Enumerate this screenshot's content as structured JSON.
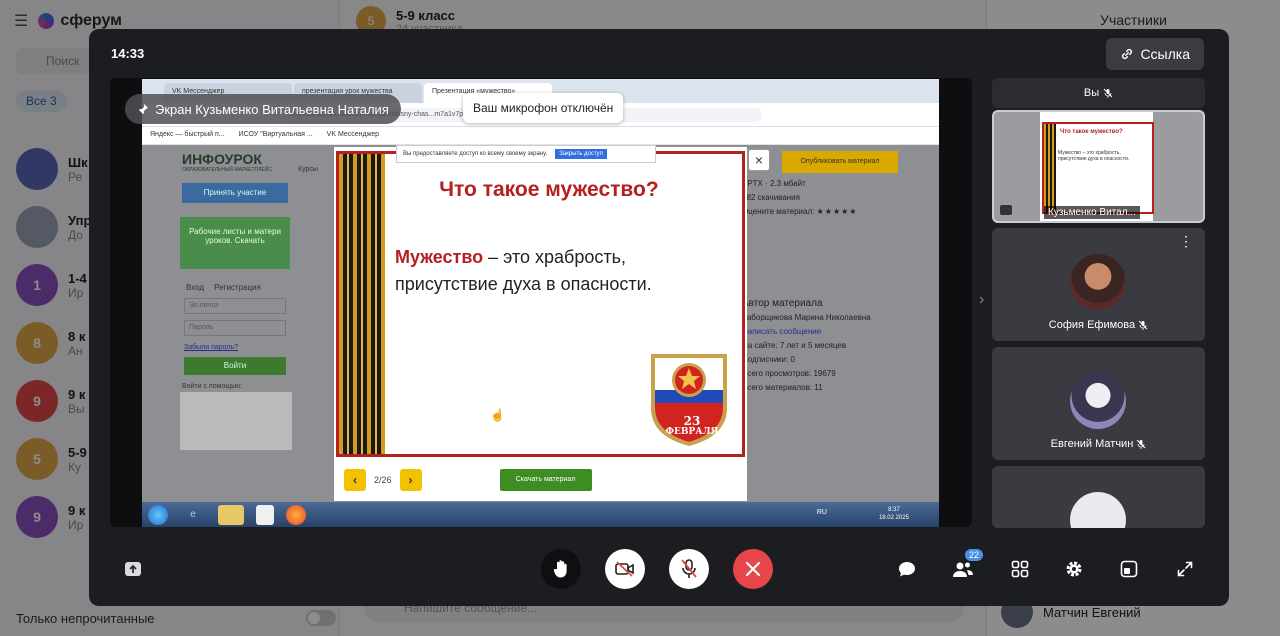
{
  "background": {
    "app_name": "сферум",
    "search_placeholder": "Поиск",
    "filter_all": "Все",
    "filter_count": "3",
    "chats": [
      {
        "initial": "",
        "title": "Шк",
        "preview": "Ре"
      },
      {
        "initial": "",
        "title": "Упр",
        "preview": "До"
      },
      {
        "initial": "1",
        "title": "1-4",
        "preview": "Ир"
      },
      {
        "initial": "8",
        "title": "8 к",
        "preview": "Ан"
      },
      {
        "initial": "9",
        "title": "9 к",
        "preview": "Вы"
      },
      {
        "initial": "5",
        "title": "5-9",
        "preview": "Ку"
      },
      {
        "initial": "9",
        "title": "9 к",
        "preview": "Ир"
      }
    ],
    "unread_only": "Только непрочитанные",
    "chat_title": "5-9 класс",
    "chat_subtitle": "24 участника",
    "chat_avatar": "5",
    "message_placeholder": "Напишите сообщение...",
    "participants_title": "Участники",
    "participant_bottom": "Матчин Евгений"
  },
  "call": {
    "time": "14:33",
    "link_label": "Ссылка",
    "pinned_label": "Экран Кузьменко Витальевна Наталия",
    "mic_off_tooltip": "Ваш микрофон отключён",
    "participants_badge": "22"
  },
  "screen": {
    "tabs": [
      "VK Мессенджер",
      "презентация урок мужества",
      "Презентация «мужество»"
    ],
    "url": "https://infourok.ru/prezentaciya-klassny-chas...m7a1v7pqwc318561758",
    "bookmarks": [
      "Яндекс — быстрый п...",
      "ИСОУ \"Виртуальная ...",
      "VK Мессенджер"
    ],
    "share_notice": "Вы предоставляете доступ ко всему своему экрану.",
    "share_stop": "Закрыть доступ",
    "site_brand": "ИНФОУРОК",
    "site_brand_sub": "ОБРАЗОВАТЕЛЬНЫЙ МАРКЕТПЛЕЙС",
    "courses": "Курсы",
    "take_part": "Принять участие",
    "green_block": "Рабочие листы и матери уроков. Скачать",
    "tab_login": "Вход",
    "tab_register": "Регистрация",
    "email_placeholder": "Эл.почта",
    "password_placeholder": "Пароль",
    "forgot": "Забыли пароль?",
    "login_btn": "Войти",
    "login_with": "Войти с помощью:",
    "publish_btn": "Опубликовать материал",
    "file_size": "PPTX · 2.3 мбайт",
    "downloads": "482 скачивания",
    "rate": "Оцените материал:",
    "stars": "★★★★★",
    "author_label": "Автор материала",
    "author_name": "Заборщикова Марина Николаевна",
    "write_msg": "Написать сообщение",
    "on_site": "На сайте: 7 лет и 5 месяцев",
    "subscribers": "Подписчики: 0",
    "views": "Всего просмотров: 19679",
    "materials": "Всего материалов: 11",
    "slide_title": "Что такое мужество?",
    "slide_keyword": "Мужество",
    "slide_text": " – это храбрость, присутствие духа в опасности.",
    "emblem_date": "23",
    "emblem_month": "ФЕВРАЛЯ",
    "page_counter": "2/26",
    "download_btn": "Скачать материал",
    "tray_lang": "RU",
    "tray_time": "8:37",
    "tray_date": "18.02.2025"
  },
  "tiles": {
    "you_label": "Вы",
    "screen_owner": "Кузьменко Витал...",
    "mini_title": "Что такое мужество?",
    "mini_body": "Мужество – это храбрость, присутствие духа в опасности.",
    "sofia": "София Ефимова",
    "evgeny": "Евгений Матчин"
  }
}
